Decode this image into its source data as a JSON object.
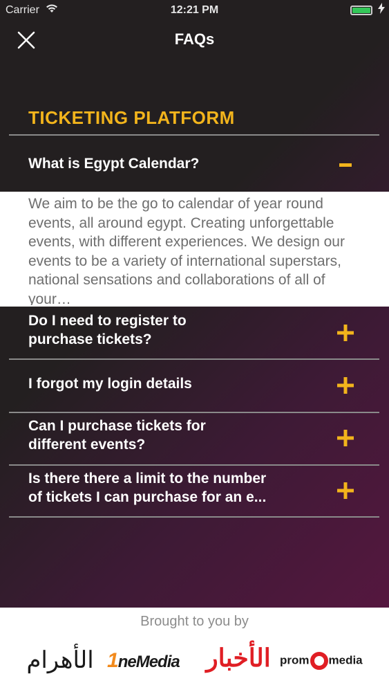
{
  "status_bar": {
    "carrier": "Carrier",
    "time": "12:21 PM",
    "battery_color": "#34c759"
  },
  "nav": {
    "title": "FAQs",
    "close_icon": "close-icon"
  },
  "section": {
    "title": "TICKETING PLATFORM",
    "accent_color": "#f2b41c"
  },
  "faqs": [
    {
      "question": "What is Egypt Calendar?",
      "expanded": true,
      "toggle_icon": "minus-icon",
      "answer": "We aim to be the go to calendar of year round events, all around egypt. Creating unforgettable events, with different experiences. We design our events to be a variety of international superstars, national sensations and collaborations of all of your…"
    },
    {
      "question_line1": "Do I need to register to",
      "question_line2": "purchase tickets?",
      "expanded": false,
      "toggle_icon": "plus-icon"
    },
    {
      "question": "I forgot my login details",
      "expanded": false,
      "toggle_icon": "plus-icon"
    },
    {
      "question_line1": "Can I purchase tickets for",
      "question_line2": "different events?",
      "expanded": false,
      "toggle_icon": "plus-icon"
    },
    {
      "question_line1": "Is there there a limit to the number",
      "question_line2": "of tickets I can purchase for an e...",
      "expanded": false,
      "toggle_icon": "plus-icon"
    }
  ],
  "footer": {
    "brought_by": "Brought to you by",
    "logos": {
      "ahram": "الأهرام",
      "onemedia_o": "1",
      "onemedia_rest": "neMedia",
      "akhbar": "الأخبار",
      "promo_left": "prom",
      "promo_right": "media"
    }
  }
}
